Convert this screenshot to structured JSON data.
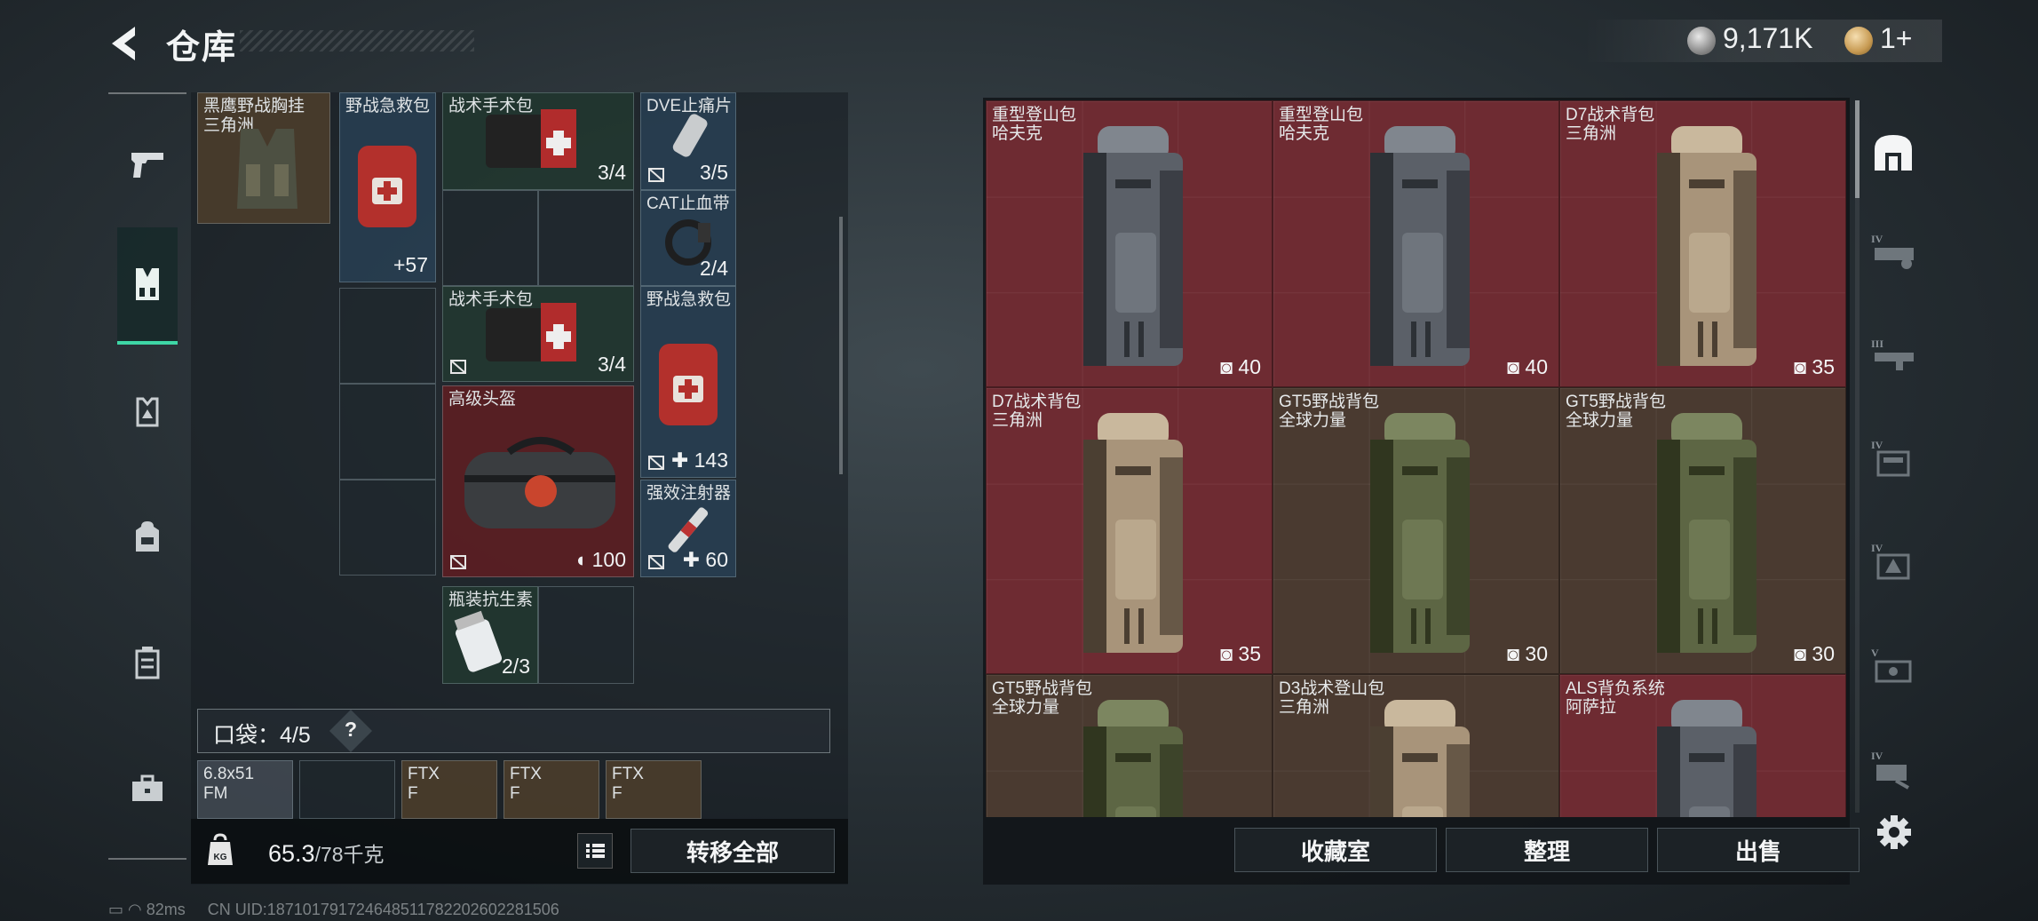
{
  "header": {
    "title": "仓库"
  },
  "currency": [
    {
      "icon": "silver-coin-icon",
      "value": "9,171K"
    },
    {
      "icon": "gold-coin-icon",
      "value": "1+"
    }
  ],
  "left_nav": [
    {
      "name": "nav-weapons",
      "icon": "pistol-icon"
    },
    {
      "name": "nav-chest-rig",
      "icon": "chest-rig-icon",
      "active": true
    },
    {
      "name": "nav-armor",
      "icon": "armor-icon"
    },
    {
      "name": "nav-backpack",
      "icon": "backpack-icon"
    },
    {
      "name": "nav-container",
      "icon": "container-icon"
    },
    {
      "name": "nav-case",
      "icon": "case-icon"
    }
  ],
  "inventory": {
    "items": [
      {
        "name": "黑鹰野战胸挂\n三角洲",
        "qty": "",
        "color": "brown"
      },
      {
        "name": "野战急救包",
        "qty": "+57",
        "color": "blue"
      },
      {
        "name": "战术手术包",
        "qty": "3/4",
        "color": "green"
      },
      {
        "name": "DVE止痛片",
        "qty": "3/5",
        "color": "blue"
      },
      {
        "name": "CAT止血带",
        "qty": "2/4",
        "color": "blue"
      },
      {
        "name": "战术手术包",
        "qty": "3/4",
        "color": "green"
      },
      {
        "name": "野战急救包",
        "qty": "143",
        "color": "blue"
      },
      {
        "name": "高级头盔",
        "qty": "100",
        "color": "red"
      },
      {
        "name": "强效注射器",
        "qty": "60",
        "color": "blue"
      },
      {
        "name": "瓶装抗生素",
        "qty": "2/3",
        "color": "green"
      }
    ],
    "pocket_label": "口袋：4/5",
    "help": "?",
    "pocket_items": [
      {
        "name": "6.8x51\nFM"
      },
      {
        "name": ""
      },
      {
        "name": "FTX\nF"
      },
      {
        "name": "FTX\nF"
      },
      {
        "name": "FTX\nF"
      }
    ],
    "weight_current": "65.3",
    "weight_max": "/78千克",
    "transfer_all": "转移全部"
  },
  "storage": {
    "items": [
      {
        "name": "重型登山包",
        "brand": "哈夫克",
        "capacity": "40",
        "color": "red",
        "bag": "gray"
      },
      {
        "name": "重型登山包",
        "brand": "哈夫克",
        "capacity": "40",
        "color": "red",
        "bag": "gray"
      },
      {
        "name": "D7战术背包",
        "brand": "三角洲",
        "capacity": "35",
        "color": "red",
        "bag": "tan"
      },
      {
        "name": "D7战术背包",
        "brand": "三角洲",
        "capacity": "35",
        "color": "red",
        "bag": "tan"
      },
      {
        "name": "GT5野战背包",
        "brand": "全球力量",
        "capacity": "30",
        "color": "olive",
        "bag": "green"
      },
      {
        "name": "GT5野战背包",
        "brand": "全球力量",
        "capacity": "30",
        "color": "olive",
        "bag": "green"
      },
      {
        "name": "GT5野战背包",
        "brand": "全球力量",
        "capacity": "",
        "color": "olive",
        "bag": "green"
      },
      {
        "name": "D3战术登山包",
        "brand": "三角洲",
        "capacity": "",
        "color": "olive",
        "bag": "tan"
      },
      {
        "name": "ALS背负系统",
        "brand": "阿萨拉",
        "capacity": "",
        "color": "red",
        "bag": "gray"
      }
    ],
    "buttons": {
      "collection": "收藏室",
      "sort": "整理",
      "sell": "出售"
    }
  },
  "right_rail": [
    {
      "name": "rail-all",
      "icon": "arch-filter-icon",
      "tier": ""
    },
    {
      "name": "rail-tier-iv-a",
      "icon": "category-icon",
      "tier": "IV"
    },
    {
      "name": "rail-tier-iii",
      "icon": "category-icon",
      "tier": "III"
    },
    {
      "name": "rail-tier-iv-b",
      "icon": "category-icon",
      "tier": "IV"
    },
    {
      "name": "rail-tier-iv-c",
      "icon": "category-icon",
      "tier": "IV"
    },
    {
      "name": "rail-tier-v",
      "icon": "category-icon",
      "tier": "V"
    },
    {
      "name": "rail-tier-iv-d",
      "icon": "category-icon",
      "tier": "IV"
    }
  ],
  "status": {
    "ping": "82ms",
    "uid": "CN UID:1871017917246485117822026022815​06"
  }
}
